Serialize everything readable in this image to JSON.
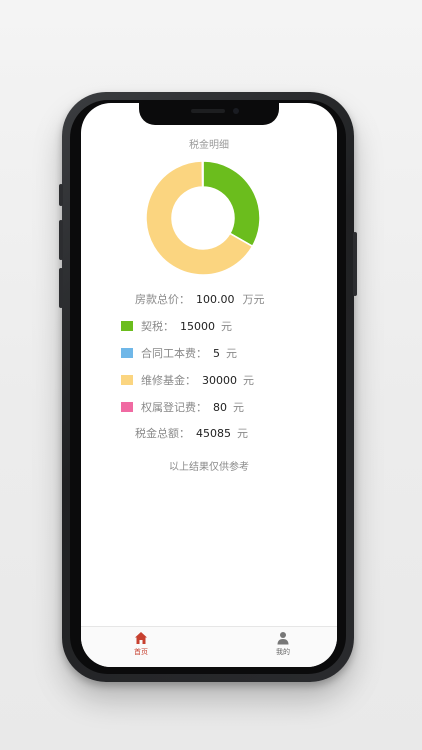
{
  "page_title": "税金明细",
  "chart_data": {
    "type": "pie",
    "title": "",
    "slices": [
      {
        "label": "契税",
        "value": 15000,
        "color": "#6bbd1d"
      },
      {
        "label": "合同工本费",
        "value": 5,
        "color": "#6fb7e8"
      },
      {
        "label": "维修基金",
        "value": 30000,
        "color": "#fbd580"
      },
      {
        "label": "权属登记费",
        "value": 80,
        "color": "#f06aa2"
      }
    ]
  },
  "price": {
    "label": "房款总价：",
    "value": "100.00",
    "unit": "万元"
  },
  "items": [
    {
      "label": "契税：",
      "value": "15000",
      "unit": "元",
      "color": "#6bbd1d"
    },
    {
      "label": "合同工本费：",
      "value": "5",
      "unit": "元",
      "color": "#6fb7e8"
    },
    {
      "label": "维修基金：",
      "value": "30000",
      "unit": "元",
      "color": "#fbd580"
    },
    {
      "label": "权属登记费：",
      "value": "80",
      "unit": "元",
      "color": "#f06aa2"
    }
  ],
  "total": {
    "label": "税金总额：",
    "value": "45085",
    "unit": "元"
  },
  "note": "以上结果仅供参考",
  "tabs": [
    {
      "label": "首页",
      "icon": "home-icon",
      "active": true
    },
    {
      "label": "我的",
      "icon": "person-icon",
      "active": false
    }
  ]
}
